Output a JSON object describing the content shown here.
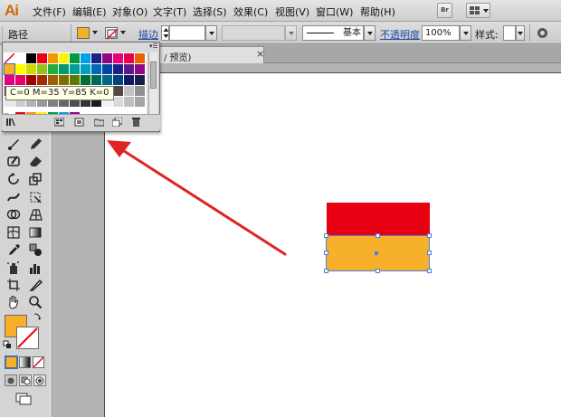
{
  "app": {
    "logo": "Ai"
  },
  "menu": {
    "items": [
      "文件(F)",
      "编辑(E)",
      "对象(O)",
      "文字(T)",
      "选择(S)",
      "效果(C)",
      "视图(V)",
      "窗口(W)",
      "帮助(H)"
    ],
    "bridge_label": "Br"
  },
  "control_bar": {
    "object_type": "路径",
    "stroke_label": "描边",
    "brush_field": "基本",
    "opacity_label": "不透明度",
    "opacity_value": "100%",
    "style_label": "样式:",
    "fill_color": "#f6b02a"
  },
  "document_tab": {
    "label": "/ 预览)",
    "close": "×"
  },
  "swatch_panel": {
    "tooltip": "C=0 M=35 Y=85 K=0",
    "menu_glyph": "▾☰",
    "rows": [
      [
        "#ffffff",
        "#000000",
        "#e60012",
        "#f39800",
        "#fff100",
        "#009944",
        "#00a0e9",
        "#1d2088",
        "#920783",
        "#e4007f",
        "#e5004f",
        "#eb6100",
        "#f8b500"
      ],
      [
        "#f6b02a",
        "#ffff00",
        "#cfdb00",
        "#8fc31f",
        "#22ac38",
        "#009b6b",
        "#009e96",
        "#00a0c1",
        "#0068b7",
        "#00479d",
        "#1d2088",
        "#601986",
        "#920783"
      ],
      [
        "#e4007f",
        "#e5006a",
        "#a40000",
        "#a42d00",
        "#a05f00",
        "#7d7000",
        "#5d7900",
        "#006e2e",
        "#00695c",
        "#006a86",
        "#00417e",
        "#101b63",
        "#1d1d4a"
      ],
      [
        "#5b0d3f",
        "#930048",
        "#c69c6d",
        "#a67c52",
        "#8c6239",
        "#754c24",
        "#603813",
        "#c7b299",
        "#998675",
        "#736357",
        "#534741",
        "#c2c2c2",
        "#8f8f8f"
      ],
      [
        "#e6e6e6",
        "#cccccc",
        "#b3b3b3",
        "#999999",
        "#808080",
        "#666666",
        "#4d4d4d",
        "#333333",
        "#1a1a1a",
        "#f2f2f2",
        "#d9d9d9",
        "#bfbfbf",
        "#a6a6a6"
      ]
    ],
    "group_row": [
      "#e60012",
      "#f39800",
      "#fff100",
      "#009944",
      "#00a0e9",
      "#920783"
    ]
  },
  "canvas": {
    "red_rect_color": "#e60012",
    "orange_rect_color": "#f6b02a",
    "arrow_color": "#e02424"
  }
}
